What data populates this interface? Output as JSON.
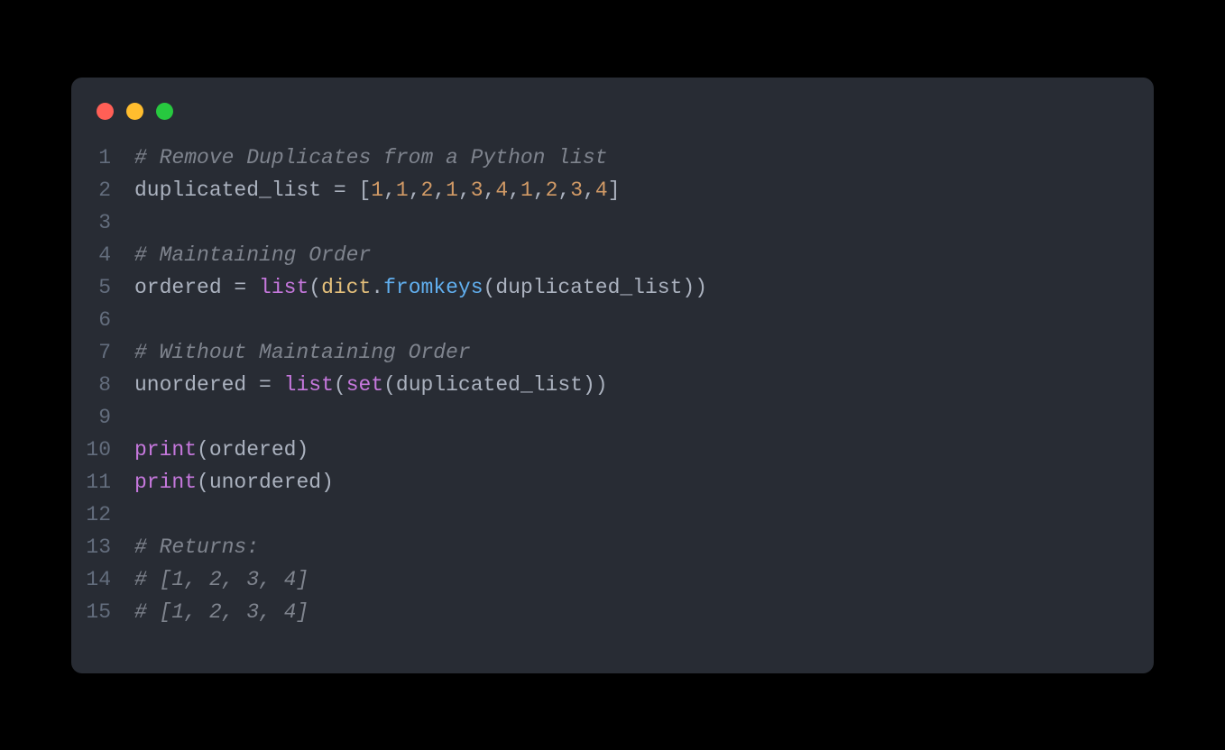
{
  "window": {
    "controls": {
      "close_color": "#ff5f56",
      "minimize_color": "#ffbd2e",
      "maximize_color": "#27c93f"
    }
  },
  "code": {
    "lines": [
      {
        "num": "1",
        "tokens": [
          {
            "t": "comment",
            "v": "# Remove Duplicates from a Python list"
          }
        ]
      },
      {
        "num": "2",
        "tokens": [
          {
            "t": "ident",
            "v": "duplicated_list"
          },
          {
            "t": "op",
            "v": " = "
          },
          {
            "t": "punct",
            "v": "["
          },
          {
            "t": "num",
            "v": "1"
          },
          {
            "t": "comma",
            "v": ","
          },
          {
            "t": "num",
            "v": "1"
          },
          {
            "t": "comma",
            "v": ","
          },
          {
            "t": "num",
            "v": "2"
          },
          {
            "t": "comma",
            "v": ","
          },
          {
            "t": "num",
            "v": "1"
          },
          {
            "t": "comma",
            "v": ","
          },
          {
            "t": "num",
            "v": "3"
          },
          {
            "t": "comma",
            "v": ","
          },
          {
            "t": "num",
            "v": "4"
          },
          {
            "t": "comma",
            "v": ","
          },
          {
            "t": "num",
            "v": "1"
          },
          {
            "t": "comma",
            "v": ","
          },
          {
            "t": "num",
            "v": "2"
          },
          {
            "t": "comma",
            "v": ","
          },
          {
            "t": "num",
            "v": "3"
          },
          {
            "t": "comma",
            "v": ","
          },
          {
            "t": "num",
            "v": "4"
          },
          {
            "t": "punct",
            "v": "]"
          }
        ]
      },
      {
        "num": "3",
        "tokens": []
      },
      {
        "num": "4",
        "tokens": [
          {
            "t": "comment",
            "v": "# Maintaining Order"
          }
        ]
      },
      {
        "num": "5",
        "tokens": [
          {
            "t": "ident",
            "v": "ordered"
          },
          {
            "t": "op",
            "v": " = "
          },
          {
            "t": "func",
            "v": "list"
          },
          {
            "t": "paren",
            "v": "("
          },
          {
            "t": "obj",
            "v": "dict"
          },
          {
            "t": "punct",
            "v": "."
          },
          {
            "t": "method",
            "v": "fromkeys"
          },
          {
            "t": "paren",
            "v": "("
          },
          {
            "t": "ident",
            "v": "duplicated_list"
          },
          {
            "t": "paren",
            "v": "))"
          }
        ]
      },
      {
        "num": "6",
        "tokens": []
      },
      {
        "num": "7",
        "tokens": [
          {
            "t": "comment",
            "v": "# Without Maintaining Order"
          }
        ]
      },
      {
        "num": "8",
        "tokens": [
          {
            "t": "ident",
            "v": "unordered"
          },
          {
            "t": "op",
            "v": " = "
          },
          {
            "t": "func",
            "v": "list"
          },
          {
            "t": "paren",
            "v": "("
          },
          {
            "t": "func",
            "v": "set"
          },
          {
            "t": "paren",
            "v": "("
          },
          {
            "t": "ident",
            "v": "duplicated_list"
          },
          {
            "t": "paren",
            "v": "))"
          }
        ]
      },
      {
        "num": "9",
        "tokens": []
      },
      {
        "num": "10",
        "tokens": [
          {
            "t": "func",
            "v": "print"
          },
          {
            "t": "paren",
            "v": "("
          },
          {
            "t": "ident",
            "v": "ordered"
          },
          {
            "t": "paren",
            "v": ")"
          }
        ]
      },
      {
        "num": "11",
        "tokens": [
          {
            "t": "func",
            "v": "print"
          },
          {
            "t": "paren",
            "v": "("
          },
          {
            "t": "ident",
            "v": "unordered"
          },
          {
            "t": "paren",
            "v": ")"
          }
        ]
      },
      {
        "num": "12",
        "tokens": []
      },
      {
        "num": "13",
        "tokens": [
          {
            "t": "comment",
            "v": "# Returns:"
          }
        ]
      },
      {
        "num": "14",
        "tokens": [
          {
            "t": "comment",
            "v": "# [1, 2, 3, 4]"
          }
        ]
      },
      {
        "num": "15",
        "tokens": [
          {
            "t": "comment",
            "v": "# [1, 2, 3, 4]"
          }
        ]
      }
    ]
  }
}
